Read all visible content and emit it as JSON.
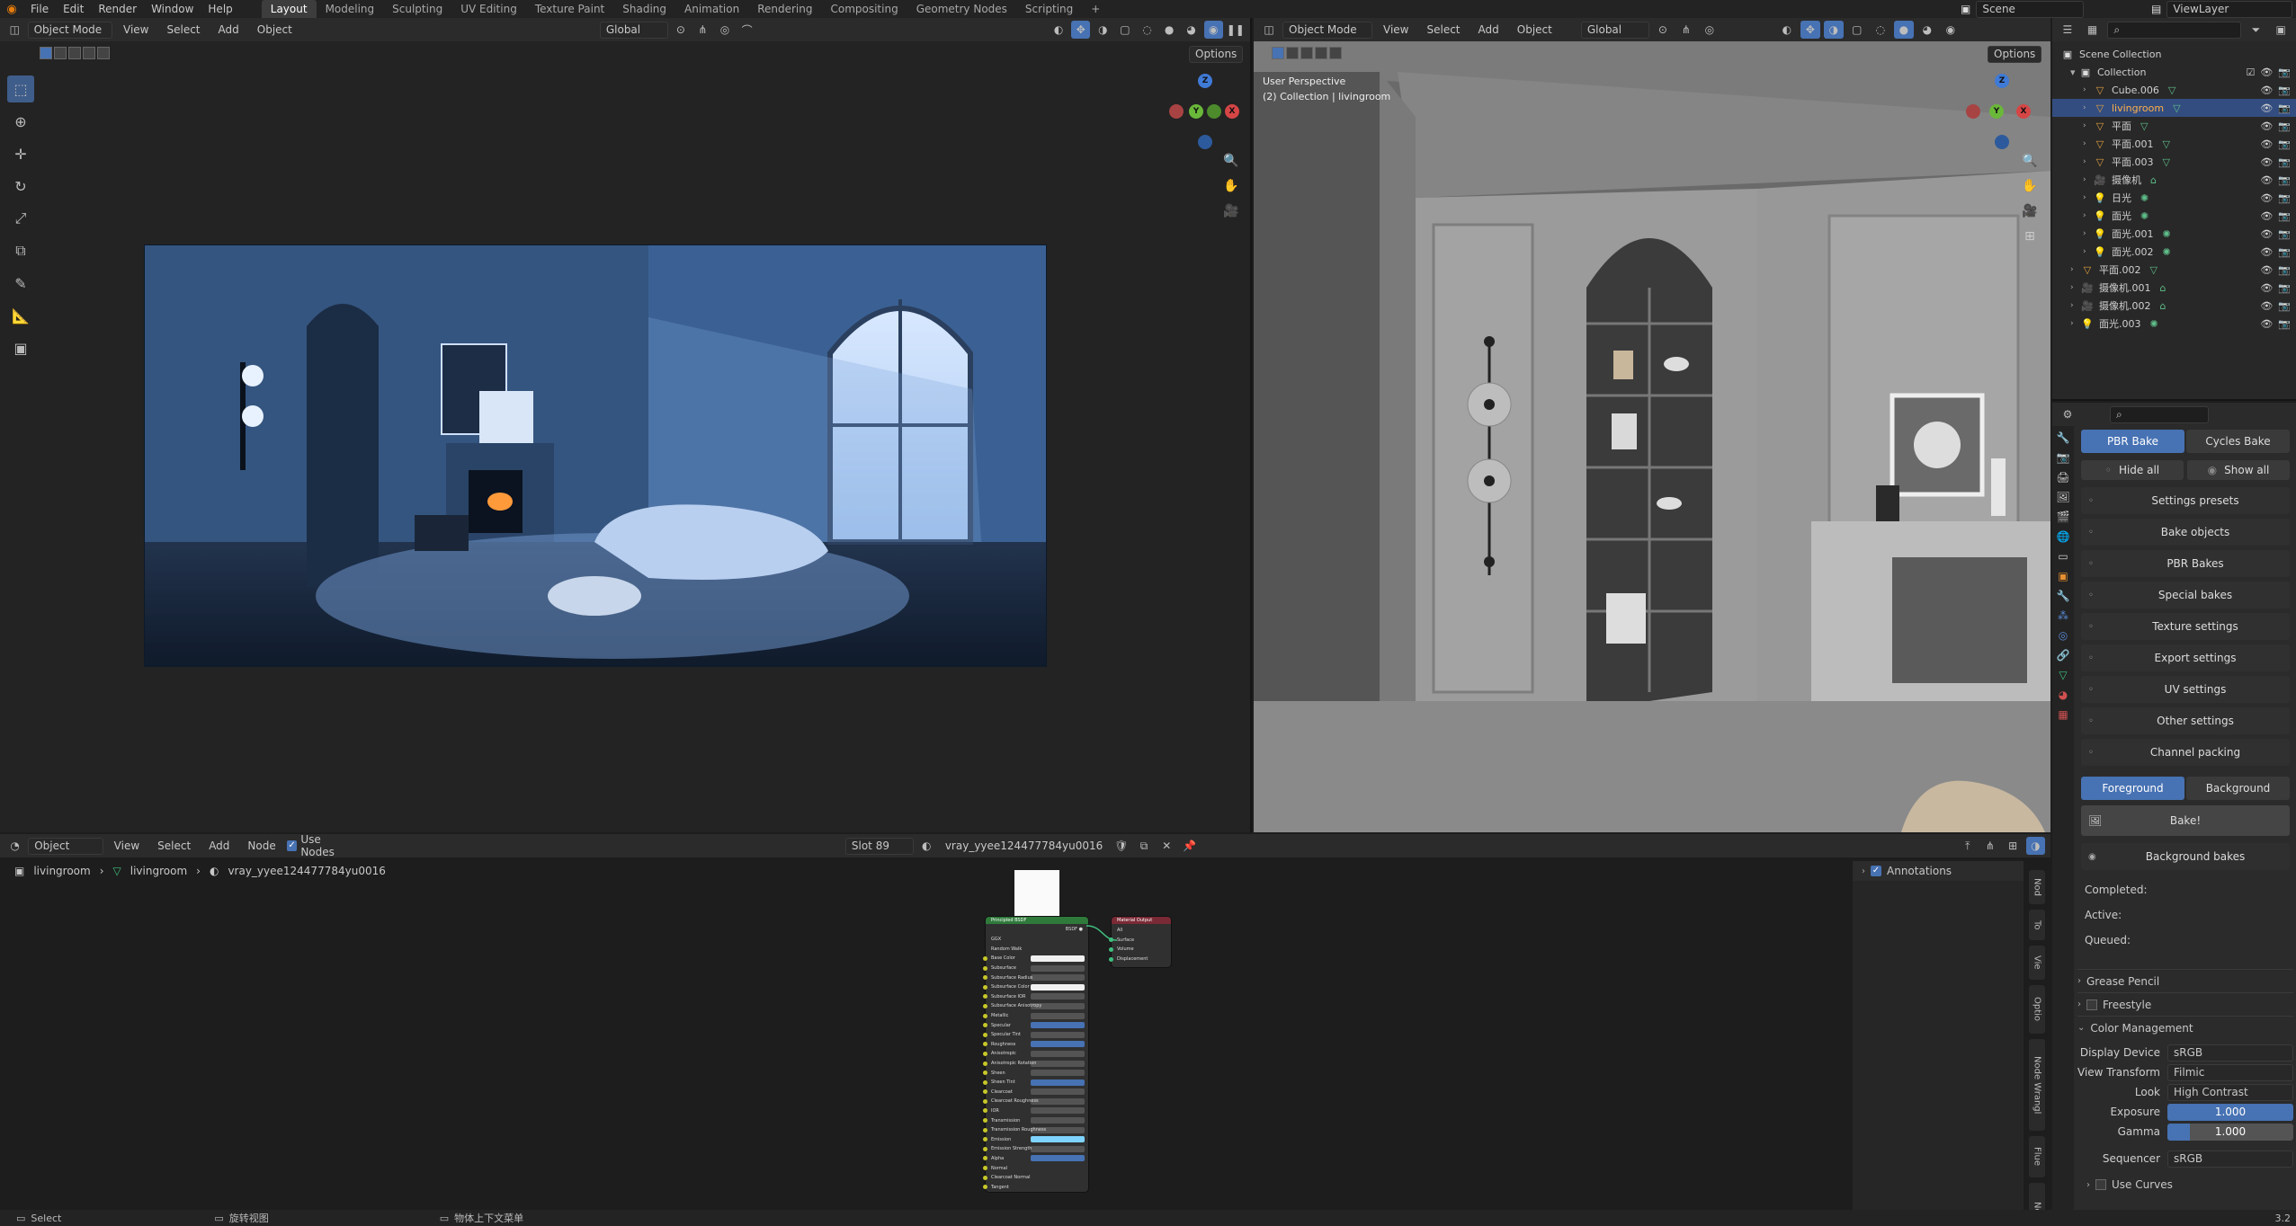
{
  "top_menu": {
    "items": [
      "File",
      "Edit",
      "Render",
      "Window",
      "Help"
    ],
    "workspaces": [
      "Layout",
      "Modeling",
      "Sculpting",
      "UV Editing",
      "Texture Paint",
      "Shading",
      "Animation",
      "Rendering",
      "Compositing",
      "Geometry Nodes",
      "Scripting"
    ],
    "scene": "Scene",
    "view_layer": "ViewLayer"
  },
  "left_viewport": {
    "mode": "Object Mode",
    "menus": [
      "View",
      "Select",
      "Add",
      "Object"
    ],
    "transform": "Global",
    "options": "Options",
    "gizmo": {
      "x": "X",
      "y": "Y",
      "z": "Z"
    }
  },
  "right_viewport": {
    "mode": "Object Mode",
    "menus": [
      "View",
      "Select",
      "Add",
      "Object"
    ],
    "transform": "Global",
    "options": "Options",
    "title": "User Perspective",
    "subtitle": "(2) Collection | livingroom"
  },
  "outliner": {
    "root": "Scene Collection",
    "collection": "Collection",
    "items": [
      {
        "name": "Cube.006",
        "icon": "mesh",
        "selected": false
      },
      {
        "name": "livingroom",
        "icon": "mesh",
        "selected": true
      },
      {
        "name": "平面",
        "icon": "mesh",
        "selected": false
      },
      {
        "name": "平面.001",
        "icon": "mesh",
        "selected": false
      },
      {
        "name": "平面.003",
        "icon": "mesh",
        "selected": false
      },
      {
        "name": "摄像机",
        "icon": "camera",
        "selected": false
      },
      {
        "name": "日光",
        "icon": "light",
        "selected": false
      },
      {
        "name": "面光",
        "icon": "light",
        "selected": false
      },
      {
        "name": "面光.001",
        "icon": "light",
        "selected": false
      },
      {
        "name": "面光.002",
        "icon": "light",
        "selected": false
      }
    ],
    "top_items": [
      {
        "name": "平面.002",
        "icon": "mesh"
      },
      {
        "name": "摄像机.001",
        "icon": "camera"
      },
      {
        "name": "摄像机.002",
        "icon": "camera"
      },
      {
        "name": "面光.003",
        "icon": "light"
      }
    ]
  },
  "properties": {
    "bake_tabs": [
      "PBR Bake",
      "Cycles Bake"
    ],
    "hide_all": "Hide all",
    "show_all": "Show all",
    "panels": [
      "Settings presets",
      "Bake objects",
      "PBR Bakes",
      "Special bakes",
      "Texture settings",
      "Export settings",
      "UV settings",
      "Other settings",
      "Channel packing"
    ],
    "fg_bg": [
      "Foreground",
      "Background"
    ],
    "bake_button": "Bake!",
    "background_bakes": "Background bakes",
    "completed": "Completed:",
    "active": "Active:",
    "queued": "Queued:",
    "grease_pencil": "Grease Pencil",
    "freestyle": "Freestyle",
    "color_management": "Color Management",
    "cm_rows": [
      {
        "k": "Display Device",
        "v": "sRGB"
      },
      {
        "k": "View Transform",
        "v": "Filmic"
      },
      {
        "k": "Look",
        "v": "High Contrast"
      }
    ],
    "exposure_label": "Exposure",
    "exposure": "1.000",
    "gamma_label": "Gamma",
    "gamma": "1.000",
    "sequencer_label": "Sequencer",
    "sequencer": "sRGB",
    "use_curves": "Use Curves"
  },
  "node_editor": {
    "editor_type": "Object",
    "menus": [
      "View",
      "Select",
      "Add",
      "Node"
    ],
    "use_nodes": "Use Nodes",
    "slot": "Slot 89",
    "material": "vray_yyee124477784yu0016",
    "breadcrumb": [
      "livingroom",
      "livingroom",
      "vray_yyee124477784yu0016"
    ],
    "annotations": "Annotations",
    "side_tabs": [
      "Nod",
      "To",
      "Vie",
      "Optio",
      "Node Wrangl",
      "Flue",
      "Node Previe"
    ],
    "bsdf_title": "Principled BSDF",
    "output_title": "Material Output",
    "bsdf_rows": [
      "GGX",
      "Random Walk",
      "Base Color",
      "Subsurface",
      "Subsurface Radius",
      "Subsurface Color",
      "Subsurface IOR",
      "Subsurface Anisotropy",
      "Metallic",
      "Specular",
      "Specular Tint",
      "Roughness",
      "Anisotropic",
      "Anisotropic Rotation",
      "Sheen",
      "Sheen Tint",
      "Clearcoat",
      "Clearcoat Roughness",
      "IOR",
      "Transmission",
      "Transmission Roughness",
      "Emission",
      "Emission Strength",
      "Alpha",
      "Normal",
      "Clearcoat Normal",
      "Tangent"
    ],
    "output_rows": [
      "All",
      "Surface",
      "Volume",
      "Displacement"
    ]
  },
  "status_bar": {
    "select": "Select",
    "rotate": "旋转视图",
    "context": "物体上下文菜单",
    "version": "3.2"
  }
}
